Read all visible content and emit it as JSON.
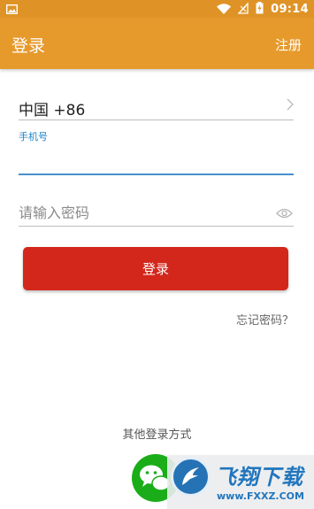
{
  "status_bar": {
    "time": "09:14",
    "icons": [
      "image-icon",
      "wifi-icon",
      "no-sim-icon",
      "battery-charging-icon"
    ]
  },
  "app_bar": {
    "title": "登录",
    "register_label": "注册"
  },
  "form": {
    "country_code": "中国 +86",
    "phone_label": "手机号",
    "phone_value": "",
    "password_placeholder": "请输入密码"
  },
  "login_button_label": "登录",
  "forgot_password_label": "忘记密码？",
  "other_login": {
    "title": "其他登录方式",
    "methods": [
      "wechat-icon"
    ]
  },
  "watermark": {
    "title": "飞翔下载",
    "domain": "www.FXXZ.COM"
  },
  "colors": {
    "app_bar": "#e69a2b",
    "status_bar": "#df9326",
    "login_button": "#d3271b",
    "label_blue": "#1f82c6",
    "wechat_green": "#1aad19"
  }
}
